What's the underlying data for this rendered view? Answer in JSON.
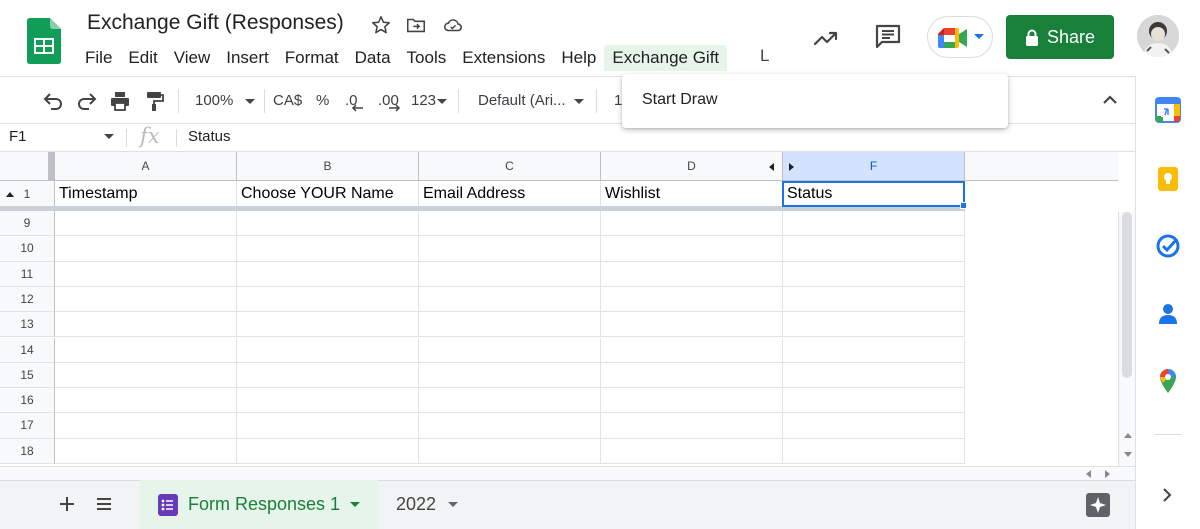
{
  "app": {
    "title": "Exchange Gift (Responses)"
  },
  "menu": {
    "items": [
      "File",
      "Edit",
      "View",
      "Insert",
      "Format",
      "Data",
      "Tools",
      "Extensions",
      "Help",
      "Exchange Gift"
    ],
    "overflow": "L",
    "active_item": "Exchange Gift"
  },
  "dropdown": {
    "items": [
      "Start Draw"
    ]
  },
  "header": {
    "share_label": "Share"
  },
  "toolbar": {
    "zoom": "100%",
    "currency": "CA$",
    "percent": "%",
    "decrease_decimal": ".0",
    "increase_decimal": ".00",
    "number_format": "123",
    "font": "Default (Ari...",
    "font_size_partial": "1"
  },
  "formula_bar": {
    "cell_ref": "F1",
    "fx": "fx",
    "value": "Status"
  },
  "grid": {
    "columns": [
      "A",
      "B",
      "C",
      "D",
      "F"
    ],
    "header_row_number": "1",
    "headers": [
      "Timestamp",
      "Choose YOUR Name",
      "Email Address",
      "Wishlist",
      "Status"
    ],
    "row_numbers": [
      "9",
      "10",
      "11",
      "12",
      "13",
      "14",
      "15",
      "16",
      "17",
      "18"
    ],
    "selected_column": "F"
  },
  "sheets": {
    "active_tab": "Form Responses 1",
    "other_tab": "2022"
  },
  "colors": {
    "brand_green": "#188038",
    "selection_blue": "#1a73e8",
    "active_menu_bg": "#e6f4ea"
  },
  "icons": [
    "sheets-logo-icon",
    "star-icon",
    "move-to-folder-icon",
    "cloud-saved-icon",
    "trending-icon",
    "comment-icon",
    "meet-icon",
    "lock-icon",
    "undo-icon",
    "redo-icon",
    "print-icon",
    "paint-format-icon",
    "chevron-down-icon",
    "chevron-up-icon",
    "add-sheet-icon",
    "all-sheets-icon",
    "calendar-icon",
    "keep-icon",
    "tasks-icon",
    "contacts-icon",
    "maps-icon",
    "chevron-right-icon",
    "explore-icon"
  ]
}
